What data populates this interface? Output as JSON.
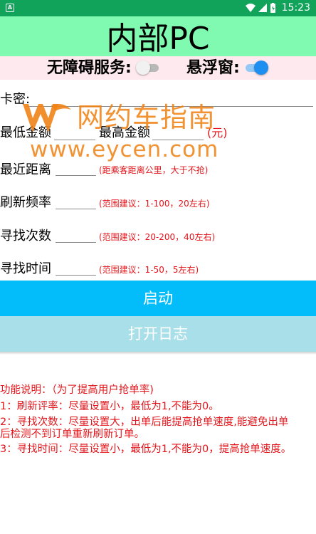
{
  "status_bar": {
    "app_icon": "A",
    "time": "15:23"
  },
  "header": {
    "title": "内部PC"
  },
  "switches": {
    "accessibility_label": "无障碍服务:",
    "accessibility_on": false,
    "floating_label": "悬浮窗:",
    "floating_on": true
  },
  "form": {
    "card_key_label": "卡密:",
    "min_amount_label": "最低金额",
    "max_amount_label": "最高金额",
    "amount_unit": "(元)",
    "distance_label": "最近距离",
    "distance_hint": "(距乘客距离公里，大于不抢)",
    "refresh_label": "刷新频率",
    "refresh_hint": "(范围建议：1-100，20左右)",
    "search_count_label": "寻找次数",
    "search_count_hint": "(范围建议：20-200，40左右)",
    "search_time_label": "寻找时间",
    "search_time_hint": "(范围建议：1-50，5左右)"
  },
  "watermark": {
    "text": "网约车指南",
    "url": "www.eycen.com"
  },
  "buttons": {
    "start": "启动",
    "open_log": "打开日志"
  },
  "description": {
    "title": "功能说明：（为了提高用户抢单率)",
    "line1": "1：刷新评率：尽量设置小，最低为1,不能为0。",
    "line2a": "2：寻找次数：尽量设置大，出单后能提高抢单速度,能避免出单",
    "line2b": "后检测不到订单重新刷新订单。",
    "line3": "3：寻找时间：尽量设置小，最低为1,不能为0，提高抢单速度。"
  },
  "colors": {
    "status_bar": "#12a35a",
    "title_bar": "#7ffab0",
    "switch_bar": "#fde9ee",
    "start_button": "#03bdfa",
    "log_button": "#a8dfe9",
    "hint_red": "#e3141a",
    "watermark_orange": "#f08317"
  },
  "icons": [
    "wifi-icon",
    "signal-icon",
    "battery-icon",
    "watermark-logo-icon"
  ]
}
